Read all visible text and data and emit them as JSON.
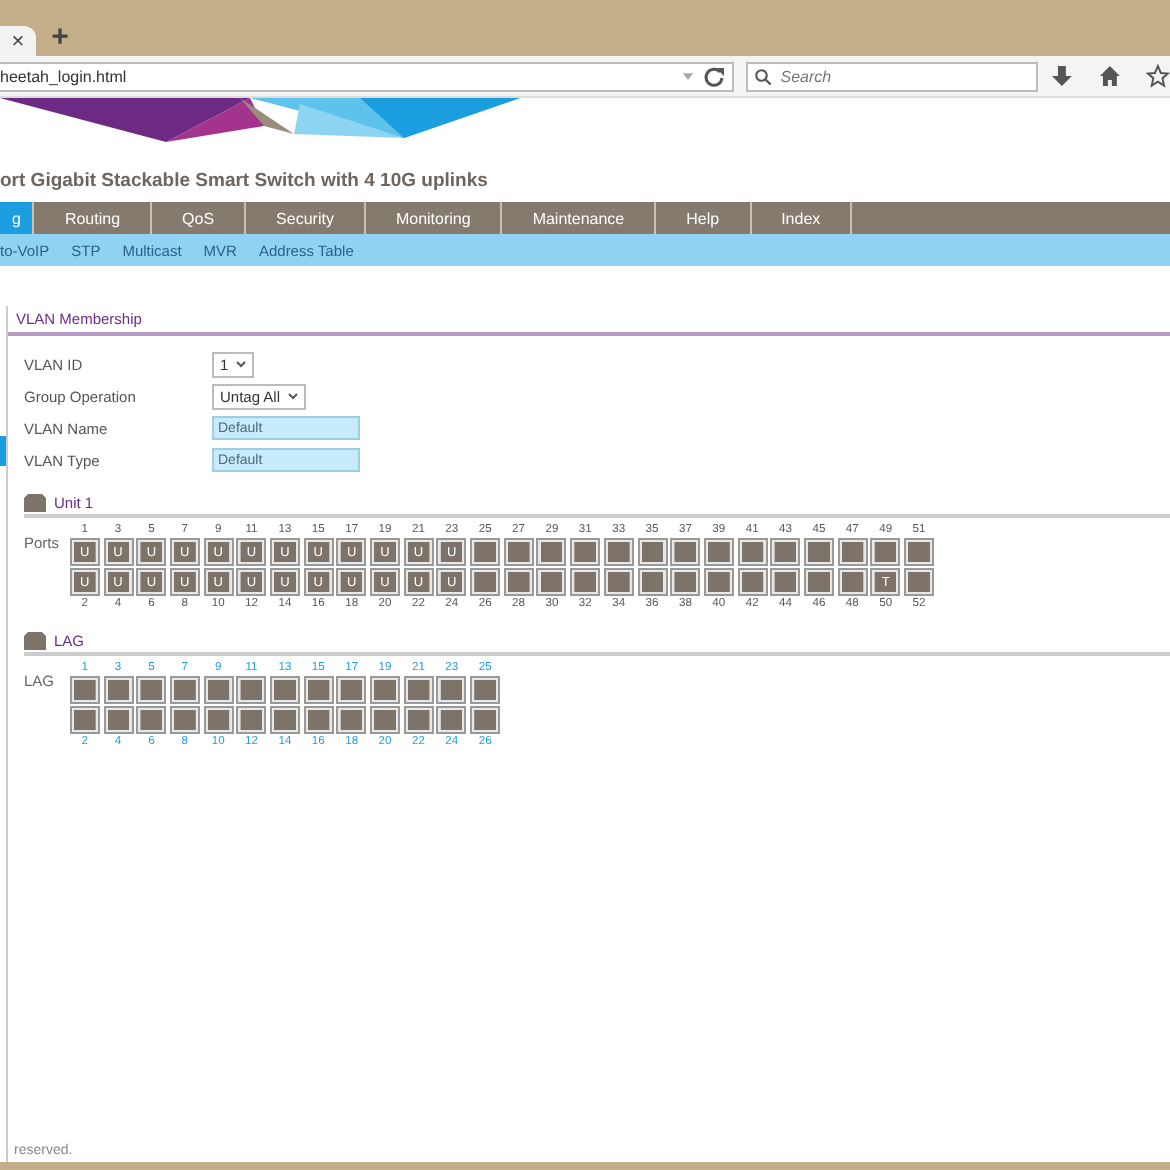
{
  "browser": {
    "tab_close": "×",
    "new_tab": "+",
    "url": "heetah_login.html",
    "search_placeholder": "Search"
  },
  "page_title": "ort Gigabit Stackable Smart Switch with 4 10G uplinks",
  "nav_tabs": [
    {
      "label": "g",
      "selected": true
    },
    {
      "label": "Routing",
      "selected": false
    },
    {
      "label": "QoS",
      "selected": false
    },
    {
      "label": "Security",
      "selected": false
    },
    {
      "label": "Monitoring",
      "selected": false
    },
    {
      "label": "Maintenance",
      "selected": false
    },
    {
      "label": "Help",
      "selected": false
    },
    {
      "label": "Index",
      "selected": false
    }
  ],
  "sub_nav": [
    {
      "label": "to-VoIP"
    },
    {
      "label": "STP"
    },
    {
      "label": "Multicast"
    },
    {
      "label": "MVR"
    },
    {
      "label": "Address Table"
    }
  ],
  "section_tab": "VLAN Membership",
  "form": [
    {
      "label": "VLAN ID",
      "kind": "select",
      "value": "1"
    },
    {
      "label": "Group Operation",
      "kind": "select",
      "value": "Untag All"
    },
    {
      "label": "VLAN Name",
      "kind": "readonly",
      "value": "Default"
    },
    {
      "label": "VLAN Type",
      "kind": "readonly",
      "value": "Default"
    }
  ],
  "unit": {
    "title": "Unit 1",
    "row_label": "Ports",
    "columns": [
      {
        "top": {
          "number": "1",
          "mark": "U"
        },
        "bottom": {
          "number": "2",
          "mark": "U"
        }
      },
      {
        "top": {
          "number": "3",
          "mark": "U"
        },
        "bottom": {
          "number": "4",
          "mark": "U"
        }
      },
      {
        "top": {
          "number": "5",
          "mark": "U"
        },
        "bottom": {
          "number": "6",
          "mark": "U"
        }
      },
      {
        "top": {
          "number": "7",
          "mark": "U"
        },
        "bottom": {
          "number": "8",
          "mark": "U"
        }
      },
      {
        "top": {
          "number": "9",
          "mark": "U"
        },
        "bottom": {
          "number": "10",
          "mark": "U"
        }
      },
      {
        "top": {
          "number": "11",
          "mark": "U"
        },
        "bottom": {
          "number": "12",
          "mark": "U"
        }
      },
      {
        "top": {
          "number": "13",
          "mark": "U"
        },
        "bottom": {
          "number": "14",
          "mark": "U"
        }
      },
      {
        "top": {
          "number": "15",
          "mark": "U"
        },
        "bottom": {
          "number": "16",
          "mark": "U"
        }
      },
      {
        "top": {
          "number": "17",
          "mark": "U"
        },
        "bottom": {
          "number": "18",
          "mark": "U"
        }
      },
      {
        "top": {
          "number": "19",
          "mark": "U"
        },
        "bottom": {
          "number": "20",
          "mark": "U"
        }
      },
      {
        "top": {
          "number": "21",
          "mark": "U"
        },
        "bottom": {
          "number": "22",
          "mark": "U"
        }
      },
      {
        "top": {
          "number": "23",
          "mark": "U"
        },
        "bottom": {
          "number": "24",
          "mark": "U"
        }
      },
      {
        "top": {
          "number": "25"
        },
        "bottom": {
          "number": "26"
        }
      },
      {
        "top": {
          "number": "27"
        },
        "bottom": {
          "number": "28"
        }
      },
      {
        "top": {
          "number": "29"
        },
        "bottom": {
          "number": "30"
        }
      },
      {
        "top": {
          "number": "31"
        },
        "bottom": {
          "number": "32"
        }
      },
      {
        "top": {
          "number": "33"
        },
        "bottom": {
          "number": "34"
        }
      },
      {
        "top": {
          "number": "35"
        },
        "bottom": {
          "number": "36"
        }
      },
      {
        "top": {
          "number": "37"
        },
        "bottom": {
          "number": "38"
        }
      },
      {
        "top": {
          "number": "39"
        },
        "bottom": {
          "number": "40"
        }
      },
      {
        "top": {
          "number": "41"
        },
        "bottom": {
          "number": "42"
        }
      },
      {
        "top": {
          "number": "43"
        },
        "bottom": {
          "number": "44"
        }
      },
      {
        "top": {
          "number": "45"
        },
        "bottom": {
          "number": "46"
        }
      },
      {
        "top": {
          "number": "47"
        },
        "bottom": {
          "number": "48"
        }
      },
      {
        "top": {
          "number": "49"
        },
        "bottom": {
          "number": "50",
          "mark": "T"
        }
      },
      {
        "top": {
          "number": "51"
        },
        "bottom": {
          "number": "52"
        }
      }
    ]
  },
  "lag": {
    "title": "LAG",
    "row_label": "LAG",
    "columns": [
      {
        "top": {
          "number": "1"
        },
        "bottom": {
          "number": "2"
        }
      },
      {
        "top": {
          "number": "3"
        },
        "bottom": {
          "number": "4"
        }
      },
      {
        "top": {
          "number": "5"
        },
        "bottom": {
          "number": "6"
        }
      },
      {
        "top": {
          "number": "7"
        },
        "bottom": {
          "number": "8"
        }
      },
      {
        "top": {
          "number": "9"
        },
        "bottom": {
          "number": "10"
        }
      },
      {
        "top": {
          "number": "11"
        },
        "bottom": {
          "number": "12"
        }
      },
      {
        "top": {
          "number": "13"
        },
        "bottom": {
          "number": "14"
        }
      },
      {
        "top": {
          "number": "15"
        },
        "bottom": {
          "number": "16"
        }
      },
      {
        "top": {
          "number": "17"
        },
        "bottom": {
          "number": "18"
        }
      },
      {
        "top": {
          "number": "19"
        },
        "bottom": {
          "number": "20"
        }
      },
      {
        "top": {
          "number": "21"
        },
        "bottom": {
          "number": "22"
        }
      },
      {
        "top": {
          "number": "23"
        },
        "bottom": {
          "number": "24"
        }
      },
      {
        "top": {
          "number": "25"
        },
        "bottom": {
          "number": "26"
        }
      }
    ]
  },
  "footer": "reserved."
}
